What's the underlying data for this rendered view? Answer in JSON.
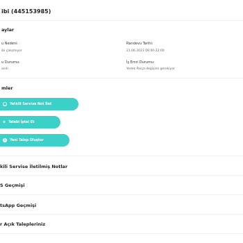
{
  "header": {
    "title": "ibi (445153985)"
  },
  "details": {
    "section_title": "aylar",
    "rows": [
      {
        "left_label": "u Nedeni:",
        "left_value": "ibi çalışmıyor",
        "right_label": "Randevu Tarihi:",
        "right_value": "21.06.2023 09:00-22:00"
      },
      {
        "left_label": "u Durumu:",
        "left_value": "andı",
        "right_label": "İş Emri Durumu:",
        "right_value": "Yedek Parça değişimi gerekiyor"
      }
    ]
  },
  "actions": {
    "section_title": "mler",
    "buttons": [
      {
        "label": "Yetkili Servise Not İlet",
        "icon": "chat-icon"
      },
      {
        "label": "Talebi İptal Et",
        "icon": "cancel-icon"
      },
      {
        "label": "Yeni Talep Oluştur",
        "icon": "plus-icon"
      }
    ]
  },
  "accordions": [
    {
      "label": "kili Servise İletilmiş Notlar"
    },
    {
      "label": "S Geçmişi"
    },
    {
      "label": "tsApp Geçmişi"
    },
    {
      "label": "r Açık Talepleriniz"
    }
  ],
  "colors": {
    "accent": "#3bd1c8",
    "divider": "#f0f0f0"
  }
}
